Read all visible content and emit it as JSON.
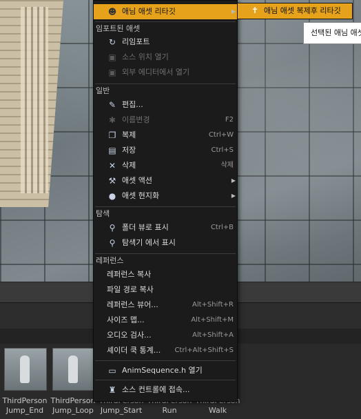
{
  "context_menu": {
    "header_item": {
      "label": "애님 애셋 리타깃",
      "icon": "retarget-icon"
    },
    "sections": [
      {
        "title": "임포트된 애셋",
        "items": [
          {
            "label": "리임포트",
            "icon": "reimport-icon",
            "disabled": false
          },
          {
            "label": "소스 위치 열기",
            "icon": "open-source-icon",
            "disabled": true
          },
          {
            "label": "외부 에디터에서 열기",
            "icon": "external-editor-icon",
            "disabled": true
          }
        ]
      },
      {
        "title": "일반",
        "items": [
          {
            "label": "편집...",
            "icon": "edit-icon",
            "disabled": false
          },
          {
            "label": "이름변경",
            "icon": "rename-icon",
            "shortcut": "F2",
            "disabled": true
          },
          {
            "label": "복제",
            "icon": "duplicate-icon",
            "shortcut": "Ctrl+W",
            "disabled": false
          },
          {
            "label": "저장",
            "icon": "save-icon",
            "shortcut": "Ctrl+S",
            "disabled": false
          },
          {
            "label": "삭제",
            "icon": "delete-icon",
            "shortcut": "삭제",
            "disabled": false
          },
          {
            "label": "애셋 액션",
            "icon": "wrench-icon",
            "submenu": true
          },
          {
            "label": "애셋 현지화",
            "icon": "globe-icon",
            "submenu": true
          }
        ]
      },
      {
        "title": "탐색",
        "items": [
          {
            "label": "폴더 뷰로 표시",
            "icon": "magnifier-icon",
            "shortcut": "Ctrl+B"
          },
          {
            "label": "탐색기 에서 표시",
            "icon": "magnifier-icon"
          }
        ]
      },
      {
        "title": "레퍼런스",
        "items": [
          {
            "label": "레퍼런스 복사"
          },
          {
            "label": "파일 경로 복사"
          },
          {
            "label": "레퍼런스 뷰어...",
            "shortcut": "Alt+Shift+R"
          },
          {
            "label": "사이즈 맵...",
            "shortcut": "Alt+Shift+M"
          },
          {
            "label": "오디오 검사...",
            "shortcut": "Alt+Shift+A"
          },
          {
            "label": "셰이더 쿡 통계...",
            "shortcut": "Ctrl+Alt+Shift+S"
          }
        ]
      }
    ],
    "open_header_item": {
      "label": "AnimSequence.h 열기",
      "icon": "code-file-icon"
    },
    "source_control_item": {
      "label": "소스 컨트롤에 접속...",
      "icon": "source-control-icon"
    }
  },
  "submenu": {
    "label": "애님 애셋 복제후 리타깃",
    "icon": "person-icon"
  },
  "tooltip": {
    "text": "선택된 애님 애셋"
  },
  "content_browser": {
    "assets": [
      {
        "line1": "ThirdPerson",
        "line2": "Jump_End"
      },
      {
        "line1": "ThirdPerson",
        "line2": "Jump_Loop"
      },
      {
        "line1": "ThirdPerson",
        "line2": "Jump_Start"
      },
      {
        "line1": "ThirdPerson",
        "line2": "Run"
      },
      {
        "line1": "ThirdPerson",
        "line2": "Walk"
      }
    ]
  }
}
